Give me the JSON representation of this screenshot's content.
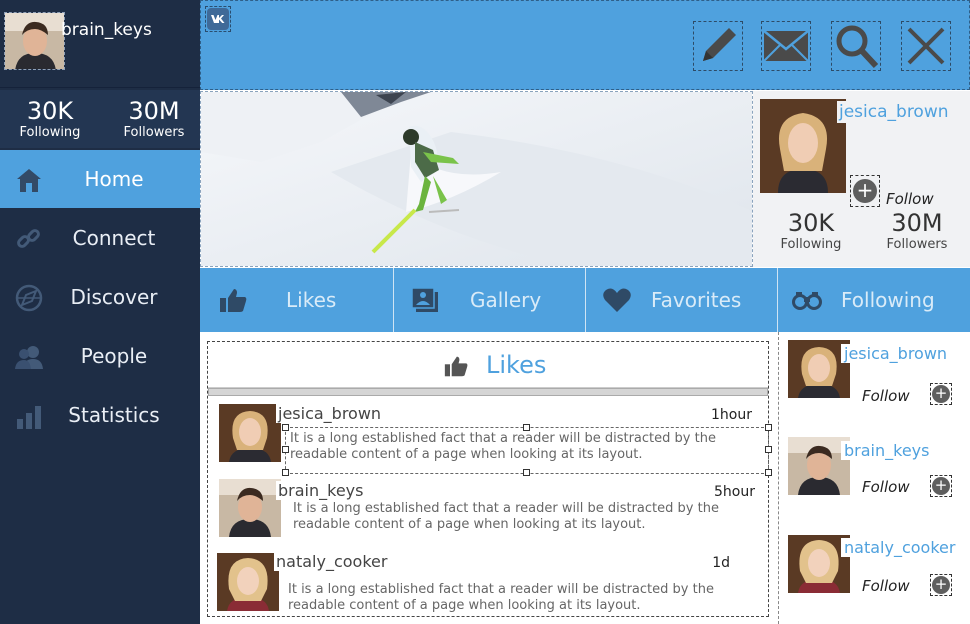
{
  "app": {
    "logo_icon": "vk-logo-icon",
    "accent": "#4fa1de",
    "sidebar_bg": "#1e2d45"
  },
  "user": {
    "username": "brain_keys",
    "following_count": "30K",
    "following_label": "Following",
    "followers_count": "30M",
    "followers_label": "Followers"
  },
  "toolbar": {
    "buttons": [
      {
        "icon": "pencil-icon"
      },
      {
        "icon": "mail-icon"
      },
      {
        "icon": "search-icon"
      },
      {
        "icon": "close-icon"
      }
    ]
  },
  "nav": {
    "items": [
      {
        "label": "Home",
        "icon": "home-icon",
        "active": true
      },
      {
        "label": "Connect",
        "icon": "link-icon",
        "active": false
      },
      {
        "label": "Discover",
        "icon": "compass-icon",
        "active": false
      },
      {
        "label": "People",
        "icon": "people-icon",
        "active": false
      },
      {
        "label": "Statistics",
        "icon": "statistics-icon",
        "active": false
      }
    ]
  },
  "profile_card": {
    "name": "jesica_brown",
    "follow_label": "Follow",
    "following_count": "30K",
    "following_label": "Following",
    "followers_count": "30M",
    "followers_label": "Followers"
  },
  "tabs": [
    {
      "label": "Likes",
      "icon": "thumbs-up-icon"
    },
    {
      "label": "Gallery",
      "icon": "gallery-icon"
    },
    {
      "label": "Favorites",
      "icon": "heart-icon"
    },
    {
      "label": "Following",
      "icon": "binoculars-icon"
    }
  ],
  "feed": {
    "title": "Likes",
    "posts": [
      {
        "name": "jesica_brown",
        "time": "1hour",
        "text": "It is a long established fact that a reader will be distracted by the readable content of a page when looking at its layout."
      },
      {
        "name": "brain_keys",
        "time": "5hour",
        "text": "It is a long established fact that a reader will be distracted by the readable content of a page when looking at its layout."
      },
      {
        "name": "nataly_cooker",
        "time": "1d",
        "text": "It is a long established fact that a reader will be distracted by the readable content of a page when looking at its layout."
      }
    ]
  },
  "suggestions": [
    {
      "name": "jesica_brown",
      "follow_label": "Follow"
    },
    {
      "name": "brain_keys",
      "follow_label": "Follow"
    },
    {
      "name": "nataly_cooker",
      "follow_label": "Follow"
    }
  ]
}
